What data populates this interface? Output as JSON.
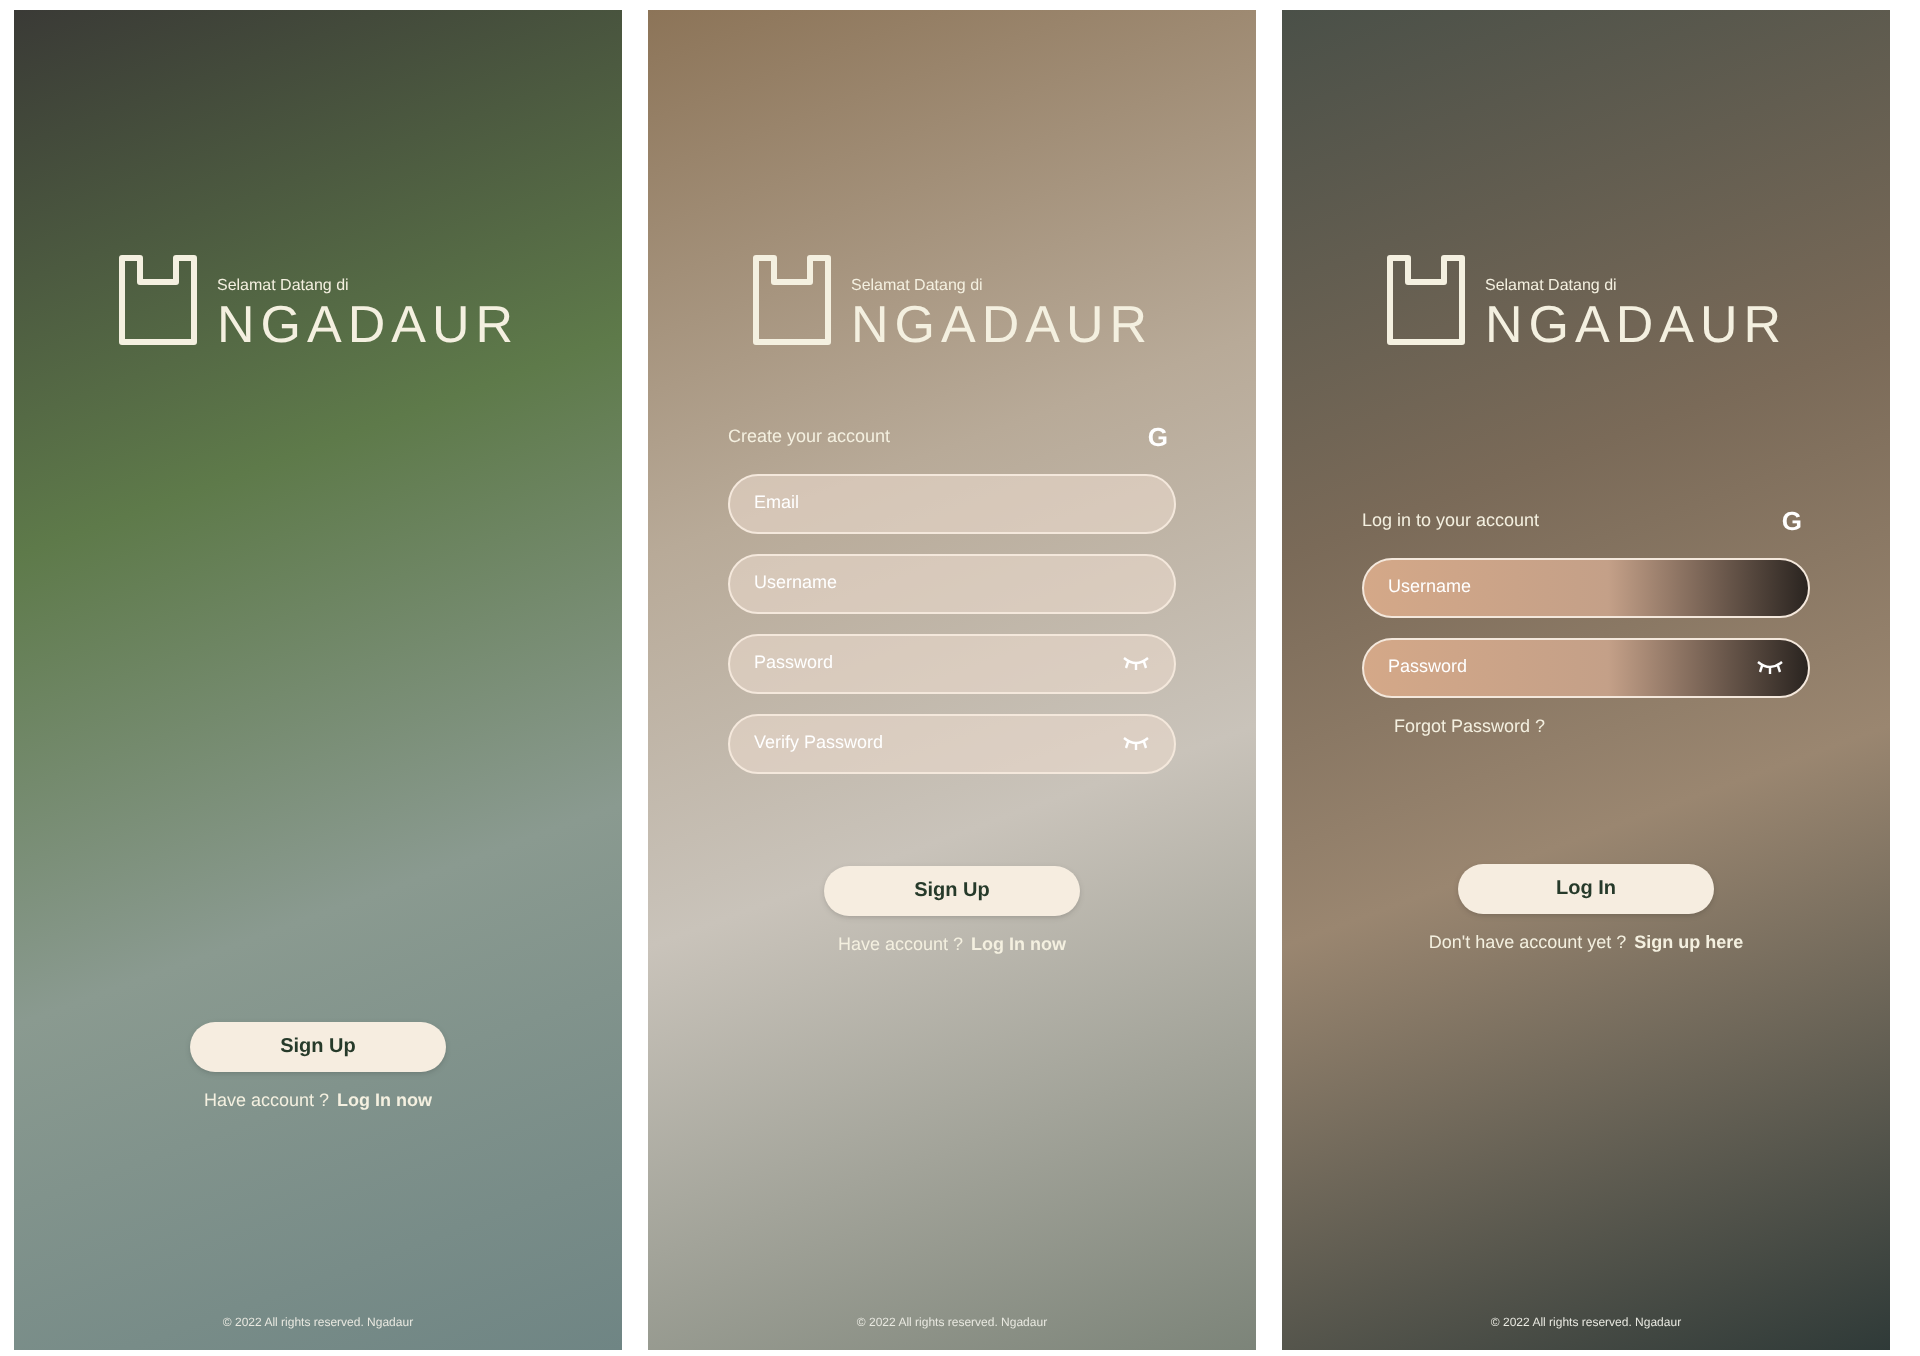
{
  "screens": [
    {
      "kind": "welcome",
      "logo": {
        "greeting": "Selamat Datang di",
        "name": "NGADAUR"
      },
      "button": "Sign Up",
      "prompt": "Have account ?",
      "link": "Log In now",
      "footer": "© 2022 All rights reserved. Ngadaur"
    },
    {
      "kind": "signup",
      "logo": {
        "greeting": "Selamat Datang di",
        "name": "NGADAUR"
      },
      "title": "Create your account",
      "google": "G",
      "fields": [
        {
          "placeholder": "Email",
          "kind": "text"
        },
        {
          "placeholder": "Username",
          "kind": "text"
        },
        {
          "placeholder": "Password",
          "kind": "password"
        },
        {
          "placeholder": "Verify Password",
          "kind": "password"
        }
      ],
      "button": "Sign Up",
      "prompt": "Have account ?",
      "link": "Log In now",
      "footer": "© 2022 All rights reserved. Ngadaur"
    },
    {
      "kind": "login",
      "logo": {
        "greeting": "Selamat Datang di",
        "name": "NGADAUR"
      },
      "title": "Log in to your account",
      "google": "G",
      "fields": [
        {
          "placeholder": "Username",
          "kind": "text"
        },
        {
          "placeholder": "Password",
          "kind": "password"
        }
      ],
      "forgot": "Forgot Password ?",
      "button": "Log In",
      "prompt": "Don't have account yet ?",
      "link": "Sign up here",
      "footer": "© 2022 All rights reserved. Ngadaur"
    }
  ]
}
